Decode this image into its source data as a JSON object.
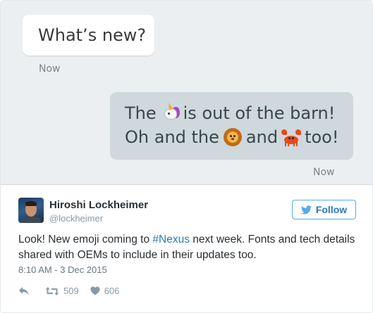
{
  "media": {
    "incoming_message": "What’s new?",
    "incoming_time": "Now",
    "outgoing_line1_part1": "The",
    "outgoing_line1_part2": "is out of the barn!",
    "outgoing_line2_part1": "Oh and the",
    "outgoing_line2_part2": "and",
    "outgoing_line2_part3": "too!",
    "outgoing_time": "Now",
    "emojis": [
      "unicorn-emoji",
      "lion-emoji",
      "crab-emoji"
    ]
  },
  "tweet": {
    "author_name": "Hiroshi Lockheimer",
    "author_handle": "@lockheimer",
    "follow_label": "Follow",
    "text_before": "Look! New emoji coming to ",
    "hashtag": "#Nexus",
    "text_after": " next week. Fonts and tech details shared with OEMs to include in their updates too.",
    "timestamp": "8:10 AM - 3 Dec 2015",
    "retweet_count": "509",
    "like_count": "606"
  },
  "colors": {
    "link": "#2b7bb9",
    "follow_border": "#55acee",
    "chat_background": "#eceff1",
    "outgoing_bubble": "#cfd8dc"
  }
}
